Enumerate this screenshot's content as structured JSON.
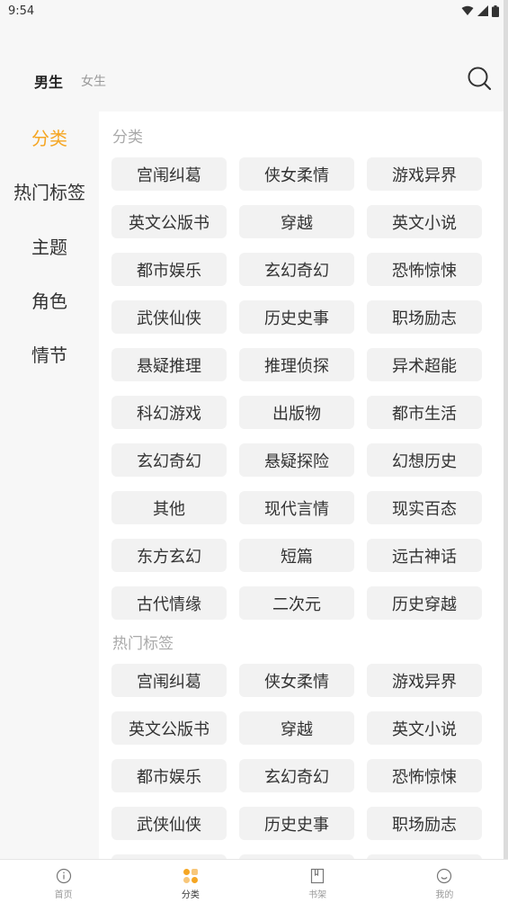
{
  "status_bar": {
    "time": "9:54"
  },
  "header": {
    "gender_tabs": [
      {
        "label": "男生",
        "active": true
      },
      {
        "label": "女生",
        "active": false
      }
    ]
  },
  "sidebar": {
    "items": [
      {
        "label": "分类",
        "active": true
      },
      {
        "label": "热门标签",
        "active": false
      },
      {
        "label": "主题",
        "active": false
      },
      {
        "label": "角色",
        "active": false
      },
      {
        "label": "情节",
        "active": false
      }
    ]
  },
  "sections": [
    {
      "title": "分类",
      "tags": [
        "宫闱纠葛",
        "侠女柔情",
        "游戏异界",
        "英文公版书",
        "穿越",
        "英文小说",
        "都市娱乐",
        "玄幻奇幻",
        "恐怖惊悚",
        "武侠仙侠",
        "历史史事",
        "职场励志",
        "悬疑推理",
        "推理侦探",
        "异术超能",
        "科幻游戏",
        "出版物",
        "都市生活",
        "玄幻奇幻",
        "悬疑探险",
        "幻想历史",
        "其他",
        "现代言情",
        "现实百态",
        "东方玄幻",
        "短篇",
        "远古神话",
        "古代情缘",
        "二次元",
        "历史穿越"
      ]
    },
    {
      "title": "热门标签",
      "tags": [
        "宫闱纠葛",
        "侠女柔情",
        "游戏异界",
        "英文公版书",
        "穿越",
        "英文小说",
        "都市娱乐",
        "玄幻奇幻",
        "恐怖惊悚",
        "武侠仙侠",
        "历史史事",
        "职场励志",
        "",
        "",
        ""
      ]
    }
  ],
  "bottom_nav": [
    {
      "label": "首页",
      "icon": "home-icon",
      "active": false
    },
    {
      "label": "分类",
      "icon": "category-icon",
      "active": true
    },
    {
      "label": "书架",
      "icon": "bookshelf-icon",
      "active": false
    },
    {
      "label": "我的",
      "icon": "profile-icon",
      "active": false
    }
  ],
  "colors": {
    "accent": "#f5a623"
  }
}
